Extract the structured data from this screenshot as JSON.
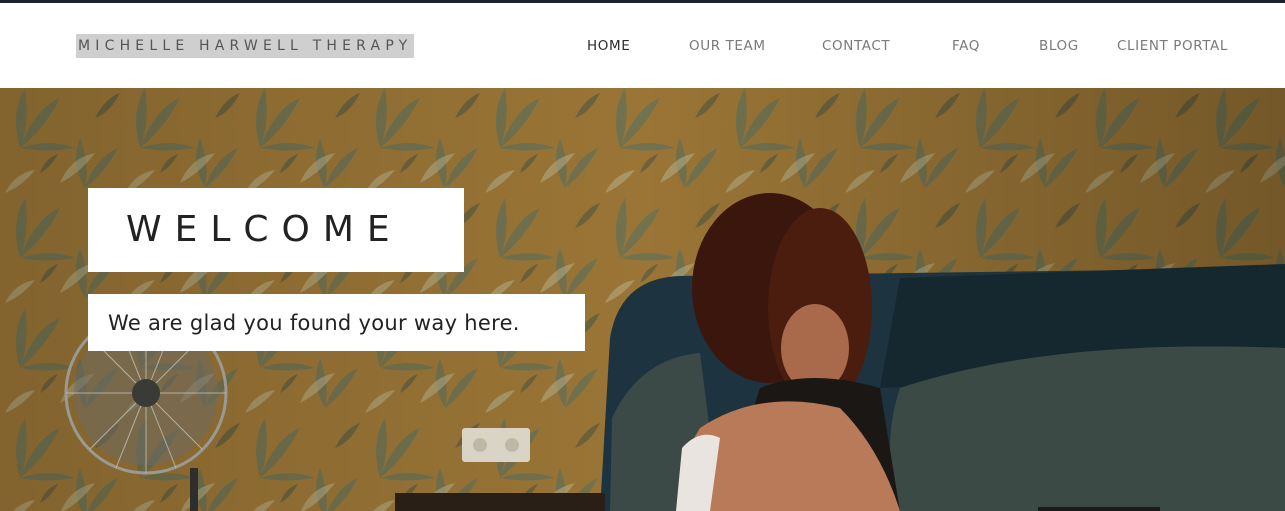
{
  "header": {
    "site_title": "MICHELLE HARWELL THERAPY",
    "nav": [
      {
        "label": "HOME",
        "active": true
      },
      {
        "label": "OUR TEAM",
        "active": false
      },
      {
        "label": "CONTACT",
        "active": false
      },
      {
        "label": "FAQ",
        "active": false
      },
      {
        "label": "BLOG",
        "active": false
      },
      {
        "label": "CLIENT PORTAL",
        "active": false
      }
    ]
  },
  "hero": {
    "heading": "WELCOME",
    "tagline": "We are glad you found your way here.",
    "image_subject": "woman-sitting-on-bed-photo"
  },
  "colors": {
    "topbar": "#1d2233",
    "nav_active": "#2b2b2b",
    "nav_inactive": "#7a7a7a",
    "logo_highlight": "#cfcfcf"
  }
}
